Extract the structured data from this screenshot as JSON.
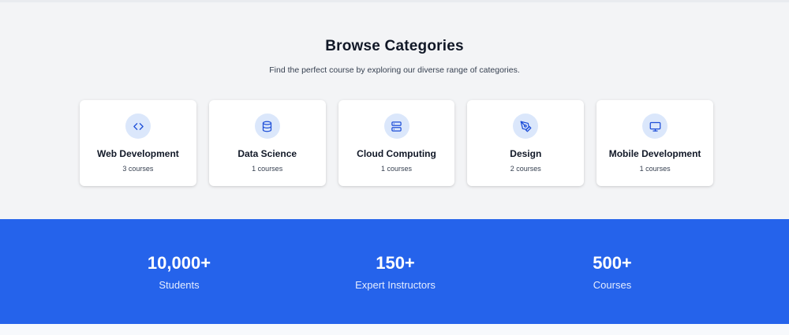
{
  "categories_section": {
    "title": "Browse Categories",
    "subtitle": "Find the perfect course by exploring our diverse range of categories.",
    "cards": [
      {
        "name": "Web Development",
        "count": "3 courses",
        "icon": "code-icon"
      },
      {
        "name": "Data Science",
        "count": "1 courses",
        "icon": "database-icon"
      },
      {
        "name": "Cloud Computing",
        "count": "1 courses",
        "icon": "server-icon"
      },
      {
        "name": "Design",
        "count": "2 courses",
        "icon": "pen-tool-icon"
      },
      {
        "name": "Mobile Development",
        "count": "1 courses",
        "icon": "monitor-icon"
      }
    ]
  },
  "stats_section": {
    "items": [
      {
        "value": "10,000+",
        "label": "Students"
      },
      {
        "value": "150+",
        "label": "Expert Instructors"
      },
      {
        "value": "500+",
        "label": "Courses"
      }
    ]
  },
  "colors": {
    "page_background": "#f3f4f6",
    "card_background": "#ffffff",
    "icon_circle": "#dbe7fb",
    "icon_stroke": "#1d4ed8",
    "stats_background": "#2563eb"
  }
}
